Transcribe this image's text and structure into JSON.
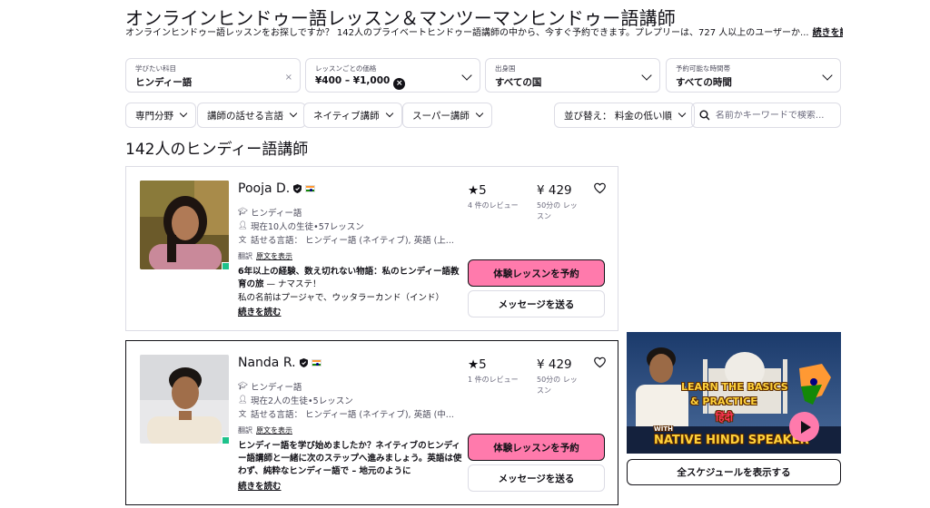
{
  "page": {
    "title": "オンラインヒンドゥー語レッスン＆マンツーマンヒンドゥー語講師",
    "subtitle": "オンラインヒンドゥー語レッスンをお探しですか？ 142人のプライベートヒンドゥー語講師の中から、今すぐ予約できます。プレプリーは、727 人以上のユーザーか...",
    "subtitle_more": "続きを読む"
  },
  "filters": {
    "subject": {
      "label": "学びたい科目",
      "value": "ヒンディー語",
      "clear": "×"
    },
    "price": {
      "label": "レッスンごとの価格",
      "value": "¥400 – ¥1,000",
      "clear": "×"
    },
    "country": {
      "label": "出身国",
      "value": "すべての国"
    },
    "time": {
      "label": "予約可能な時間帯",
      "value": "すべての時間"
    }
  },
  "chips": {
    "specialty": "専門分野",
    "tutor_language": "講師の話せる言語",
    "native": "ネイティブ講師",
    "super": "スーパー講師",
    "sort": "並び替え： 料金の低い順",
    "search_placeholder": "名前かキーワードで検索..."
  },
  "results_heading": "142人のヒンディー語講師",
  "tutors": [
    {
      "name": "Pooja D.",
      "subject": "ヒンディー語",
      "students": "現在10人の生徒•57レッスン",
      "languages": "話せる言語： ヒンディー語 (ネイティブ), 英語 (上...",
      "translated": "翻訳",
      "show_original": "原文を表示",
      "headline": "6年以上の経験、数え切れない物語：私のヒンディー語教育の旅",
      "headline_extra": " — ナマステ！",
      "desc": "私の名前はプージャで、ウッタラーカンド（インド）",
      "read_more": "続きを読む",
      "rating": "5",
      "reviews": "4 件のレビュー",
      "price": "¥ 429",
      "duration": "50分の レッスン",
      "trial_btn": "体験レッスンを予約",
      "message_btn": "メッセージを送る"
    },
    {
      "name": "Nanda R.",
      "subject": "ヒンディー語",
      "students": "現在2人の生徒•5レッスン",
      "languages": "話せる言語： ヒンディー語 (ネイティブ), 英語 (中...",
      "translated": "翻訳",
      "show_original": "原文を表示",
      "headline": "ヒンディー語を学び始めましたか？ネイティブのヒンディー語講師と一緒に次のステップへ進みましょう。英語は使わず、純粋なヒンディー語で – 地元のように",
      "read_more": "続きを読む",
      "rating": "5",
      "reviews": "1 件のレビュー",
      "price": "¥ 429",
      "duration": "50分の レッスン",
      "trial_btn": "体験レッスンを予約",
      "message_btn": "メッセージを送る"
    }
  ],
  "video": {
    "line1": "LEARN THE BASICS",
    "line2": "& PRACTICE",
    "line3": "हिंदी",
    "line4": "WITH",
    "line5": "NATIVE HINDI SPEAKER"
  },
  "schedule_btn": "全スケジュールを表示する",
  "colors": {
    "accent_pink": "#ff7aac",
    "border": "#dcdce5",
    "text": "#121117",
    "online": "#1ec28b"
  }
}
